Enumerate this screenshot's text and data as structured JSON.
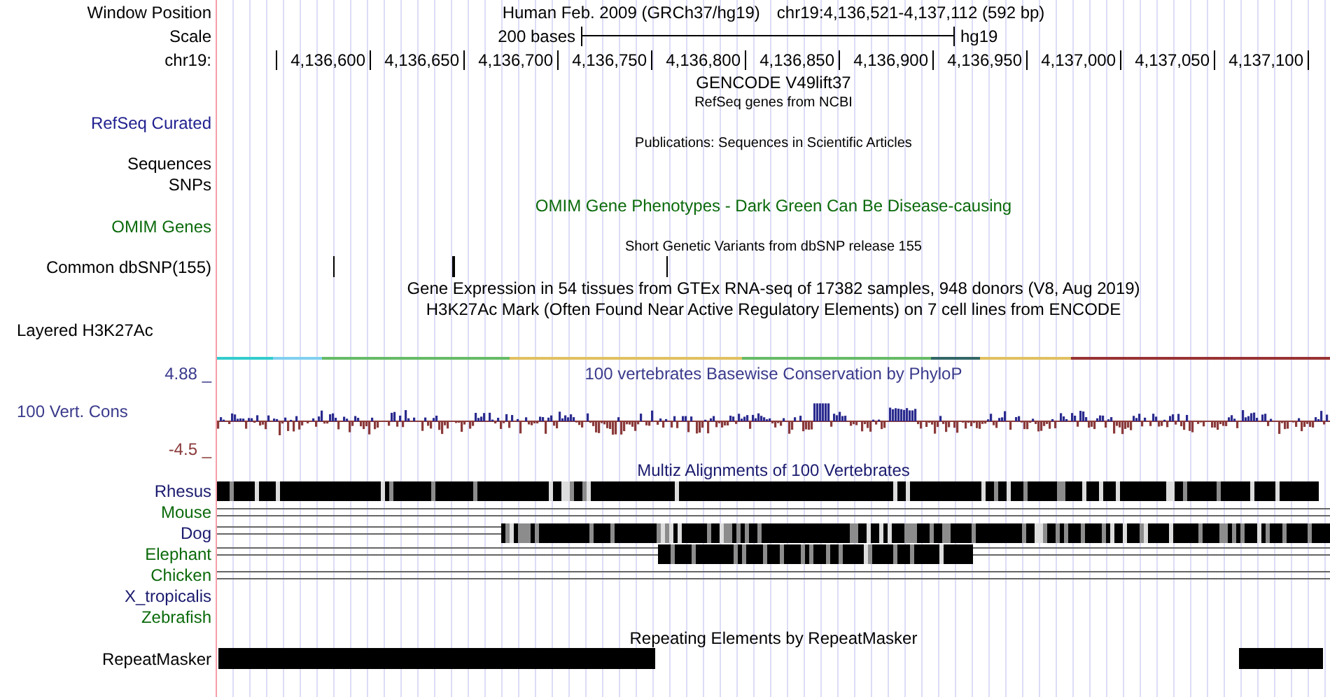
{
  "tracks": [
    {
      "kind": "header",
      "label": "Window Position",
      "title": "Human Feb. 2009 (GRCh37/hg19)",
      "position": "chr19:4,136,521-4,137,112 (592 bp)"
    },
    {
      "kind": "scale",
      "label": "Scale",
      "title": "200 bases",
      "assembly": "hg19"
    },
    {
      "kind": "ruler",
      "label": "chr19:",
      "ticks": [
        "4,136,600",
        "4,136,650",
        "4,136,700",
        "4,136,750",
        "4,136,800",
        "4,136,850",
        "4,136,900",
        "4,136,950",
        "4,137,000",
        "4,137,050",
        "4,137,100"
      ]
    },
    {
      "kind": "title",
      "title": "GENCODE V49lift37"
    },
    {
      "kind": "small_title",
      "title": "RefSeq genes from NCBI"
    },
    {
      "kind": "label",
      "label": "RefSeq Curated",
      "color": "#1f1f8f"
    },
    {
      "kind": "small_title",
      "title": "Publications: Sequences in Scientific Articles"
    },
    {
      "kind": "label",
      "label": "Sequences"
    },
    {
      "kind": "label",
      "label": "SNPs"
    },
    {
      "kind": "title",
      "title": "OMIM Gene Phenotypes - Dark Green Can Be Disease-causing",
      "color": "#0b6a0b"
    },
    {
      "kind": "label",
      "label": "OMIM Genes",
      "color": "#0b6a0b"
    },
    {
      "kind": "small_title",
      "title": "Short Genetic Variants from dbSNP release 155"
    },
    {
      "kind": "snp_marks",
      "label": "Common dbSNP(155)"
    },
    {
      "kind": "title",
      "title": "Gene Expression in 54 tissues from GTEx RNA-seq of 17382 samples, 948 donors (V8, Aug 2019)"
    },
    {
      "kind": "title",
      "title": "H3K27Ac Mark (Often Found Near Active Regulatory Elements) on 7 cell lines from ENCODE"
    },
    {
      "kind": "left_label",
      "label": "Layered H3K27Ac"
    },
    {
      "kind": "signal_line"
    },
    {
      "kind": "title",
      "label": "4.88 _",
      "title": "100 vertebrates Basewise Conservation by PhyloP",
      "color": "#3a3a8c"
    },
    {
      "kind": "wiggle",
      "label": "100 Vert. Cons",
      "color": "#3a3a8c"
    },
    {
      "kind": "label",
      "label": "-4.5 _",
      "color": "#8b3a3a"
    },
    {
      "kind": "title",
      "title": "Multiz Alignments of 100 Vertebrates",
      "color": "#1a1a6e"
    },
    {
      "kind": "alignment",
      "label": "Rhesus",
      "color": "#1a1a6e"
    },
    {
      "kind": "alignment",
      "label": "Mouse",
      "color": "#0b6a0b"
    },
    {
      "kind": "alignment",
      "label": "Dog",
      "color": "#1a1a6e"
    },
    {
      "kind": "alignment",
      "label": "Elephant",
      "color": "#0b6a0b"
    },
    {
      "kind": "alignment",
      "label": "Chicken",
      "color": "#0b6a0b"
    },
    {
      "kind": "alignment",
      "label": "X_tropicalis",
      "color": "#1a1a6e"
    },
    {
      "kind": "alignment",
      "label": "Zebrafish",
      "color": "#0b6a0b"
    },
    {
      "kind": "title",
      "title": "Repeating Elements by RepeatMasker"
    },
    {
      "kind": "repeats",
      "label": "RepeatMasker"
    }
  ]
}
